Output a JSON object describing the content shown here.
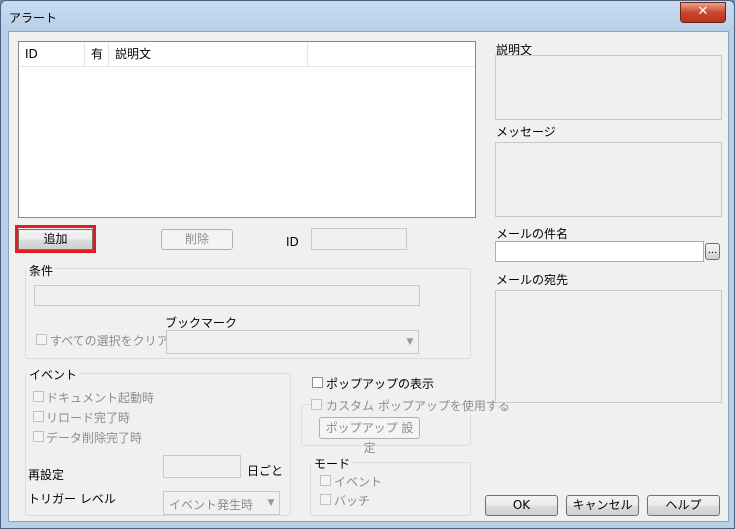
{
  "window": {
    "title": "アラート",
    "close_glyph": "✕"
  },
  "list": {
    "columns": [
      "ID",
      "有",
      "説明文",
      ""
    ]
  },
  "buttons": {
    "add": "追加",
    "delete": "削除",
    "ellipsis": "...",
    "popup_settings": "ポップアップ 設定",
    "ok": "OK",
    "cancel": "キャンセル",
    "help": "ヘルプ"
  },
  "id_label": "ID",
  "conditions": {
    "title": "条件",
    "clear_all_label": "すべての選択をクリア",
    "bookmark_label": "ブックマーク"
  },
  "events": {
    "title": "イベント",
    "doc_launch": "ドキュメント起動時",
    "reload_done": "リロード完了時",
    "data_delete_done": "データ削除完了時",
    "reset_label": "再設定",
    "per_day": "日ごと",
    "trigger_level_label": "トリガー レベル",
    "trigger_level_value": "イベント発生時"
  },
  "popup": {
    "show_label": "ポップアップの表示",
    "custom_label": "カスタム ポップアップを使用する"
  },
  "mode": {
    "title": "モード",
    "event": "イベント",
    "batch": "バッチ"
  },
  "right_panel": {
    "description_label": "説明文",
    "message_label": "メッセージ",
    "mail_subject_label": "メールの件名",
    "mail_recipient_label": "メールの宛先"
  },
  "colors": {
    "highlight": "#e31b23"
  }
}
